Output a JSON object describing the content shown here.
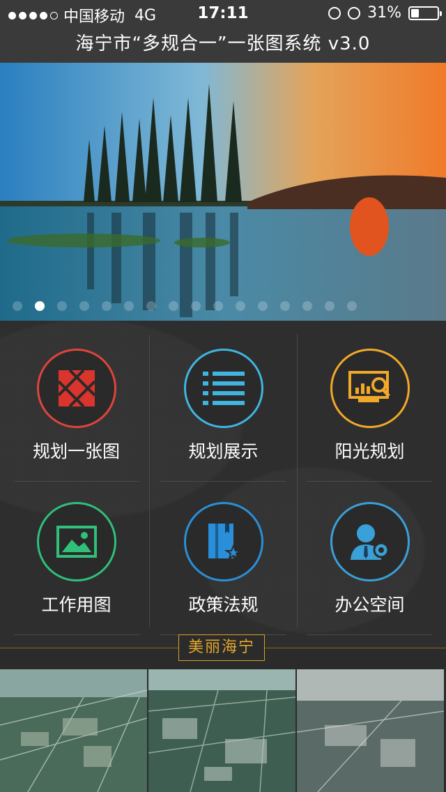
{
  "status": {
    "carrier": "中国移动",
    "network": "4G",
    "time": "17:11",
    "battery": "31%",
    "battery_level": 0.31
  },
  "header": {
    "title": "海宁市“多规合一”一张图系统 v3.0"
  },
  "banner": {
    "page_count": 16,
    "active_index": 1
  },
  "menu": {
    "items": [
      {
        "label": "规划一张图",
        "icon": "map-grid-icon",
        "color": "#e0443a"
      },
      {
        "label": "规划展示",
        "icon": "list-icon",
        "color": "#3fb5e0"
      },
      {
        "label": "阳光规划",
        "icon": "monitor-search-icon",
        "color": "#f2a92a"
      },
      {
        "label": "工作用图",
        "icon": "image-icon",
        "color": "#2fc07a"
      },
      {
        "label": "政策法规",
        "icon": "book-star-icon",
        "color": "#2a8fd8"
      },
      {
        "label": "办公空间",
        "icon": "user-gear-icon",
        "color": "#3aa0d8"
      }
    ]
  },
  "section": {
    "title": "美丽海宁"
  },
  "colors": {
    "accent": "#e6a82a",
    "background": "#2b2b2b"
  }
}
